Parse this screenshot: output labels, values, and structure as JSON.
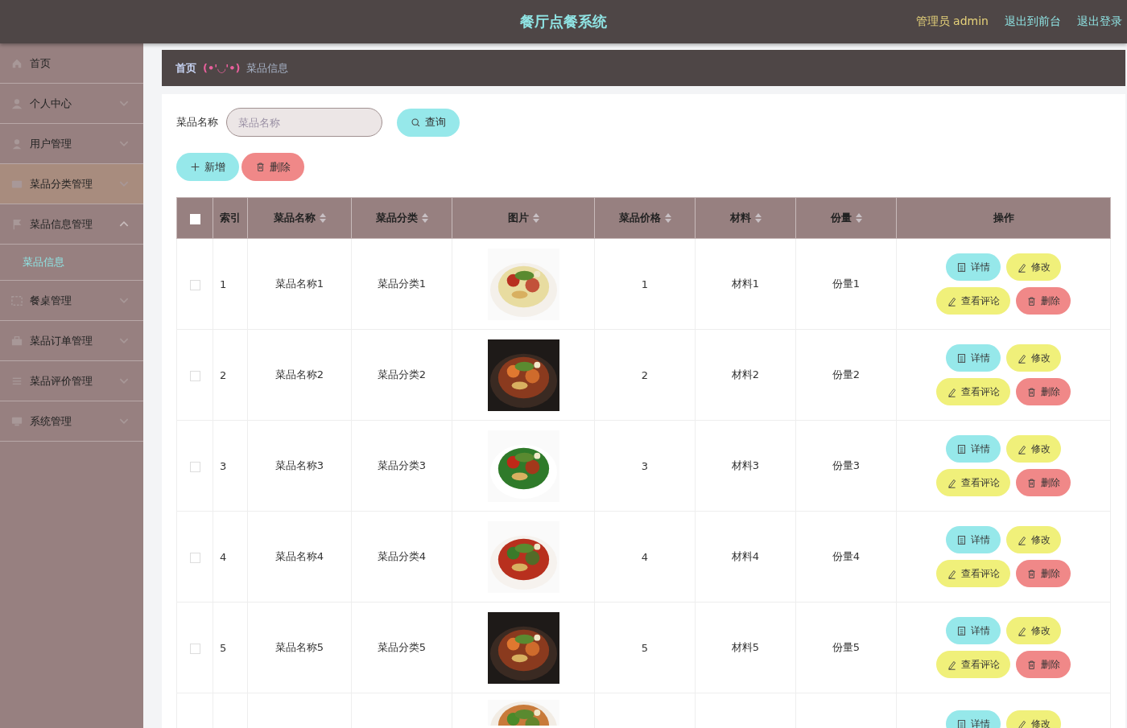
{
  "header": {
    "title": "餐厅点餐系统",
    "user": "管理员 admin",
    "links": [
      "退出到前台",
      "退出登录"
    ]
  },
  "sidebar": {
    "items": [
      {
        "label": "首页",
        "highlighted": false
      },
      {
        "label": "个人中心",
        "expanded": false,
        "highlighted": false
      },
      {
        "label": "用户管理",
        "expanded": false,
        "highlighted": false
      },
      {
        "label": "菜品分类管理",
        "expanded": false,
        "highlighted": true
      },
      {
        "label": "菜品信息管理",
        "expanded": true,
        "highlighted": false,
        "children": [
          {
            "label": "菜品信息",
            "selected": true
          }
        ]
      },
      {
        "label": "餐桌管理",
        "expanded": false,
        "highlighted": false
      },
      {
        "label": "菜品订单管理",
        "expanded": false,
        "highlighted": false
      },
      {
        "label": "菜品评价管理",
        "expanded": false,
        "highlighted": false
      },
      {
        "label": "系统管理",
        "expanded": false,
        "highlighted": false
      }
    ]
  },
  "breadcrumb": {
    "home": "首页",
    "separator": "(•'◡'•)",
    "current": "菜品信息"
  },
  "search": {
    "label": "菜品名称",
    "placeholder": "菜品名称",
    "button": "查询"
  },
  "toolbar": [
    {
      "kind": "add",
      "label": "新增"
    },
    {
      "kind": "delete",
      "label": "删除"
    }
  ],
  "table": {
    "select_all": {
      "checked": false
    },
    "columns": [
      {
        "label": "索引",
        "sortable": false
      },
      {
        "label": "菜品名称",
        "sortable": true
      },
      {
        "label": "菜品分类",
        "sortable": true
      },
      {
        "label": "图片",
        "sortable": true
      },
      {
        "label": "菜品价格",
        "sortable": true
      },
      {
        "label": "材料",
        "sortable": true
      },
      {
        "label": "份量",
        "sortable": true
      },
      {
        "label": "操作",
        "sortable": false
      }
    ],
    "rows": [
      {
        "checked": false,
        "cells": [
          "1",
          "菜品名称1",
          "菜品分类1",
          "1",
          "材料1",
          "份量1"
        ],
        "actions": [
          {
            "kind": "detail",
            "label": "详情"
          },
          {
            "kind": "edit",
            "label": "修改"
          },
          {
            "kind": "comment",
            "label": "查看评论"
          },
          {
            "kind": "delete",
            "label": "删除"
          }
        ]
      },
      {
        "checked": false,
        "cells": [
          "2",
          "菜品名称2",
          "菜品分类2",
          "2",
          "材料2",
          "份量2"
        ],
        "actions": [
          {
            "kind": "detail",
            "label": "详情"
          },
          {
            "kind": "edit",
            "label": "修改"
          },
          {
            "kind": "comment",
            "label": "查看评论"
          },
          {
            "kind": "delete",
            "label": "删除"
          }
        ]
      },
      {
        "checked": false,
        "cells": [
          "3",
          "菜品名称3",
          "菜品分类3",
          "3",
          "材料3",
          "份量3"
        ],
        "actions": [
          {
            "kind": "detail",
            "label": "详情"
          },
          {
            "kind": "edit",
            "label": "修改"
          },
          {
            "kind": "comment",
            "label": "查看评论"
          },
          {
            "kind": "delete",
            "label": "删除"
          }
        ]
      },
      {
        "checked": false,
        "cells": [
          "4",
          "菜品名称4",
          "菜品分类4",
          "4",
          "材料4",
          "份量4"
        ],
        "actions": [
          {
            "kind": "detail",
            "label": "详情"
          },
          {
            "kind": "edit",
            "label": "修改"
          },
          {
            "kind": "comment",
            "label": "查看评论"
          },
          {
            "kind": "delete",
            "label": "删除"
          }
        ]
      },
      {
        "checked": false,
        "cells": [
          "5",
          "菜品名称5",
          "菜品分类5",
          "5",
          "材料5",
          "份量5"
        ],
        "actions": [
          {
            "kind": "detail",
            "label": "详情"
          },
          {
            "kind": "edit",
            "label": "修改"
          },
          {
            "kind": "comment",
            "label": "查看评论"
          },
          {
            "kind": "delete",
            "label": "删除"
          }
        ]
      },
      {
        "actions": [
          {
            "kind": "detail",
            "label": "详情"
          },
          {
            "kind": "edit",
            "label": "修改"
          }
        ]
      }
    ]
  }
}
